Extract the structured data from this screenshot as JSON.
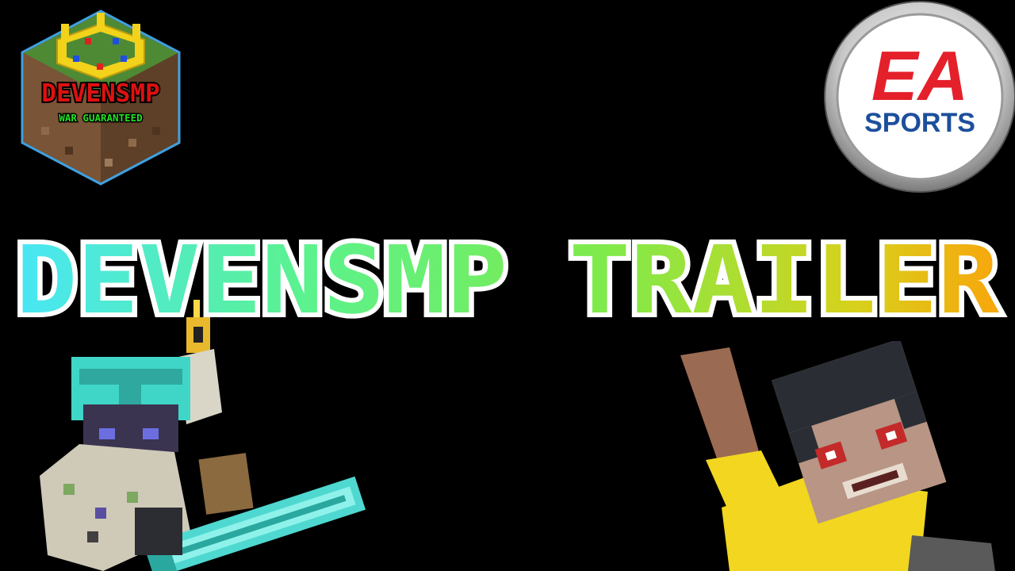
{
  "server_logo": {
    "name": "DEVENSMP",
    "tagline": "WAR GUARANTEED"
  },
  "brand_logo": {
    "line1": "EA",
    "line2": "SPORTS"
  },
  "title": {
    "text": "DEVENSMP TRAILER",
    "gradient": [
      "#48E6F6",
      "#5CF28C",
      "#7FEA4A",
      "#D6D21C",
      "#F8A60C"
    ]
  },
  "characters": [
    {
      "name": "diamond-helmet-player-with-diamond-sword"
    },
    {
      "name": "dark-haired-player-in-yellow-shirt"
    }
  ],
  "colors": {
    "background": "#000000",
    "server_name": "#E01010",
    "tagline": "#22E022",
    "ea_red": "#E4202A",
    "ea_blue": "#1C4F9C"
  }
}
